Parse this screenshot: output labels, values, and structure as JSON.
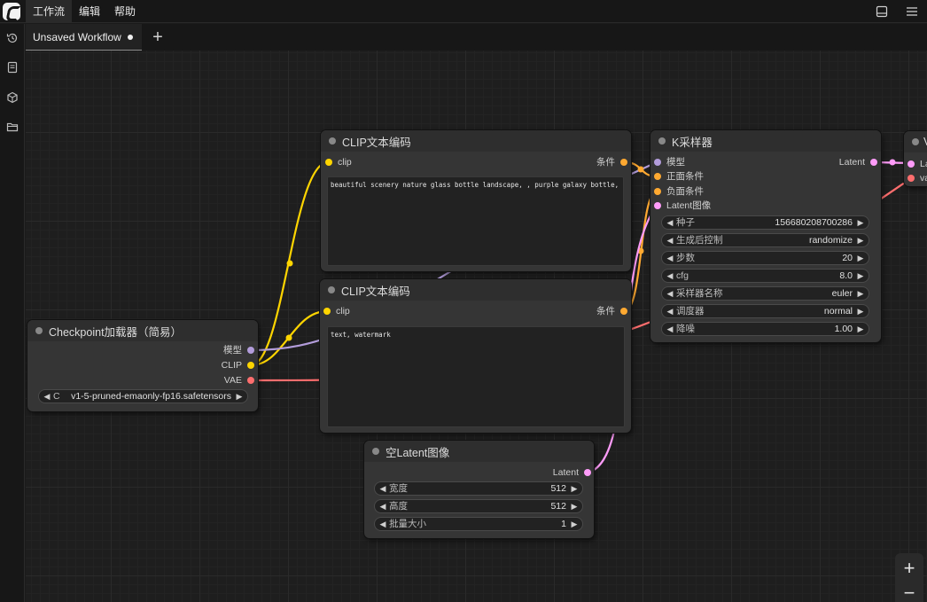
{
  "menubar": {
    "items": [
      "工作流",
      "编辑",
      "帮助"
    ]
  },
  "sidebar": {
    "icons": [
      "history-icon",
      "document-icon",
      "cube-icon",
      "folder-icon"
    ]
  },
  "tabs": [
    {
      "label": "Unsaved Workflow",
      "modified": true
    }
  ],
  "nodes": {
    "clip_pos": {
      "title": "CLIP文本编码",
      "input": "clip",
      "output": "条件",
      "text": "beautiful scenery nature glass bottle landscape, , purple galaxy bottle,"
    },
    "clip_neg": {
      "title": "CLIP文本编码",
      "input": "clip",
      "output": "条件",
      "text": "text, watermark"
    },
    "checkpoint": {
      "title": "Checkpoint加载器（简易）",
      "outputs": [
        "模型",
        "CLIP",
        "VAE"
      ],
      "ckpt_label": "C",
      "ckpt_value": "v1-5-pruned-emaonly-fp16.safetensors"
    },
    "ksampler": {
      "title": "K采样器",
      "inputs": [
        "模型",
        "正面条件",
        "负面条件",
        "Latent图像"
      ],
      "output": "Latent",
      "widgets": [
        {
          "label": "种子",
          "value": "156680208700286"
        },
        {
          "label": "生成后控制",
          "value": "randomize"
        },
        {
          "label": "步数",
          "value": "20"
        },
        {
          "label": "cfg",
          "value": "8.0"
        },
        {
          "label": "采样器名称",
          "value": "euler"
        },
        {
          "label": "调度器",
          "value": "normal"
        },
        {
          "label": "降噪",
          "value": "1.00"
        }
      ]
    },
    "empty_latent": {
      "title": "空Latent图像",
      "output": "Latent",
      "widgets": [
        {
          "label": "宽度",
          "value": "512"
        },
        {
          "label": "高度",
          "value": "512"
        },
        {
          "label": "批量大小",
          "value": "1"
        }
      ]
    },
    "vae_decode": {
      "title": "V",
      "inputs": [
        "La",
        "va"
      ]
    }
  },
  "colors": {
    "model": "#b39ddb",
    "clip": "#ffd500",
    "vae": "#ff6e6e",
    "conditioning": "#ffa931",
    "latent": "#ff9cf9"
  },
  "zoom": {
    "in_label": "+",
    "out_label": "−"
  }
}
